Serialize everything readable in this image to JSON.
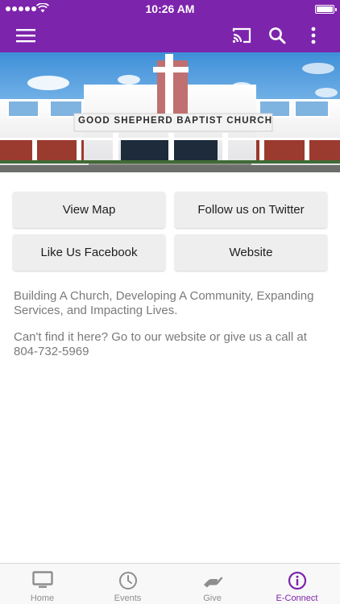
{
  "status_bar": {
    "time": "10:26 AM"
  },
  "colors": {
    "brand": "#7d24ac",
    "tab_inactive": "#8e8e8e",
    "button_bg": "#eeeeef",
    "text_muted": "#7a7a7a"
  },
  "toolbar": {
    "menu_icon": "hamburger-menu-icon",
    "cast_icon": "cast-icon",
    "search_icon": "search-icon",
    "more_icon": "more-vertical-icon"
  },
  "hero": {
    "church_sign": "GOOD SHEPHERD BAPTIST CHURCH"
  },
  "buttons": [
    {
      "label": "View Map"
    },
    {
      "label": "Follow us on Twitter"
    },
    {
      "label": "Like Us Facebook"
    },
    {
      "label": "Website"
    }
  ],
  "description": {
    "tagline": "Building A Church, Developing A Community, Expanding Services, and Impacting Lives.",
    "contact": "Can't find it here? Go to our website or give us a call at 804-732-5969"
  },
  "tabbar": {
    "active": "E-Connect",
    "tabs": [
      {
        "label": "Home",
        "icon": "monitor-icon"
      },
      {
        "label": "Events",
        "icon": "clock-icon"
      },
      {
        "label": "Give",
        "icon": "giving-hand-icon"
      },
      {
        "label": "E-Connect",
        "icon": "info-icon"
      }
    ]
  }
}
